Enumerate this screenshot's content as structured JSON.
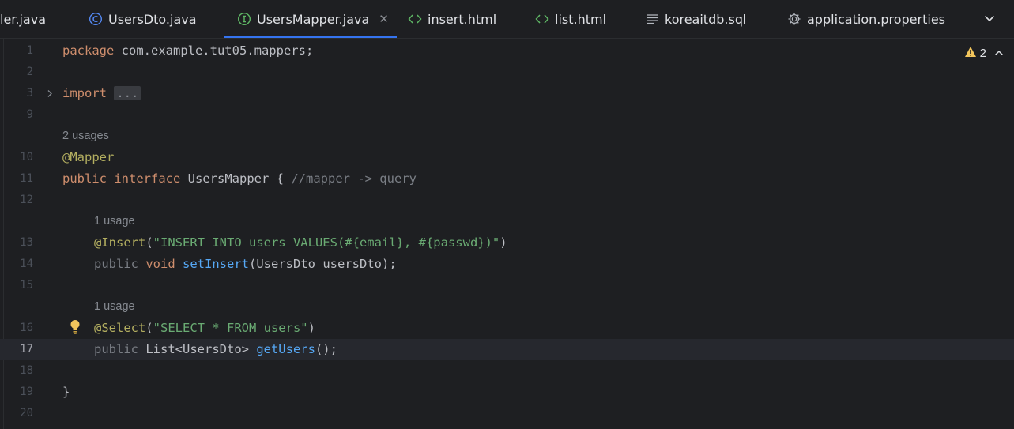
{
  "tabs": [
    {
      "label": "ler.java",
      "icon": "none"
    },
    {
      "label": "UsersDto.java",
      "icon": "class-icon"
    },
    {
      "label": "UsersMapper.java",
      "icon": "interface-icon",
      "active": true,
      "close": "✕"
    },
    {
      "label": "insert.html",
      "icon": "html-icon"
    },
    {
      "label": "list.html",
      "icon": "html-icon"
    },
    {
      "label": "koreaitdb.sql",
      "icon": "sql-icon"
    },
    {
      "label": "application.properties",
      "icon": "gear-icon"
    }
  ],
  "warnings": {
    "count": "2"
  },
  "editor": {
    "current_line": "17",
    "lines": {
      "l1": {
        "num": "1",
        "t1": "package",
        "t2": " com.example.tut05.mappers;"
      },
      "l2": {
        "num": "2"
      },
      "l3": {
        "num": "3",
        "t1": "import",
        "t2": " ",
        "fold": "..."
      },
      "l9": {
        "num": "9"
      },
      "h1": "2 usages",
      "l10": {
        "num": "10",
        "t1": "@Mapper"
      },
      "l11": {
        "num": "11",
        "t1": "public",
        "t2": " ",
        "t3": "interface",
        "t4": " UsersMapper { ",
        "t5": "//mapper -> query"
      },
      "l12": {
        "num": "12"
      },
      "h2": "1 usage",
      "l13": {
        "num": "13",
        "t1": "@Insert",
        "t2": "(",
        "t3": "\"INSERT INTO users VALUES(#{email}, #{passwd})\"",
        "t4": ")"
      },
      "l14": {
        "num": "14",
        "t1": "public",
        "t2": " ",
        "t3": "void",
        "t4": " ",
        "t5": "setInsert",
        "t6": "(UsersDto usersDto);"
      },
      "l15": {
        "num": "15"
      },
      "h3": "1 usage",
      "l16": {
        "num": "16",
        "t1": "@Select",
        "t2": "(",
        "t3": "\"SELECT * FROM users\"",
        "t4": ")"
      },
      "l17": {
        "num": "17",
        "t1": "public",
        "t2": " List<UsersDto> ",
        "t3": "getUsers",
        "t4": "();"
      },
      "l18": {
        "num": "18"
      },
      "l19": {
        "num": "19",
        "t1": "}"
      },
      "l20": {
        "num": "20"
      }
    }
  },
  "colors": {
    "background": "#1e1f22",
    "accent": "#3574f0",
    "keyword": "#cf8e6d",
    "annotation": "#b3ae60",
    "string": "#6aab73",
    "function": "#56a8f5",
    "warning": "#f2c55c"
  }
}
